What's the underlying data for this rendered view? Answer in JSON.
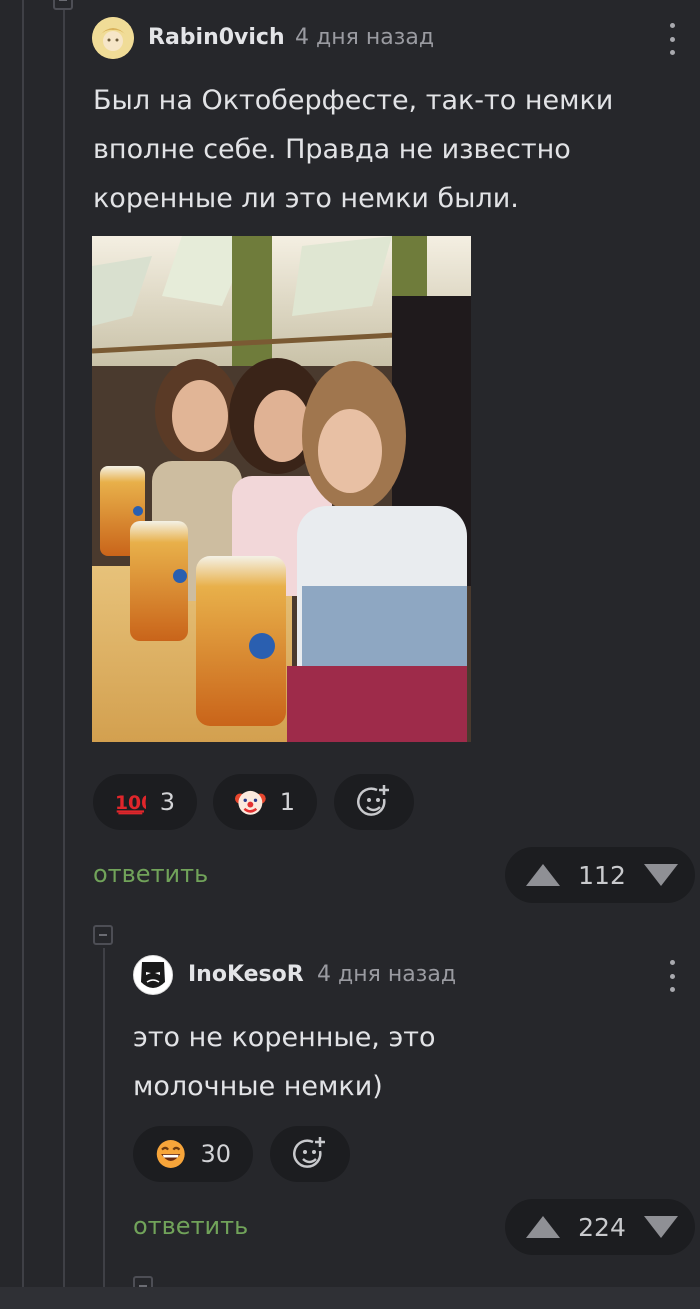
{
  "comments": [
    {
      "username": "Rabin0vich",
      "time": "4 дня назад",
      "text_lines": [
        "Был на Октоберфесте, так-то немки",
        "вполне себе. Правда не известно",
        "коренные ли это немки были."
      ],
      "reactions": [
        {
          "icon": "hundred-points-emoji",
          "count": "3"
        },
        {
          "icon": "clown-face-emoji",
          "count": "1"
        }
      ],
      "add_reaction_icon": "add-reaction-icon",
      "reply_label": "ответить",
      "rating": "112"
    },
    {
      "username": "InoKesoR",
      "time": "4 дня назад",
      "text_lines": [
        "это не коренные, это",
        "молочные немки)"
      ],
      "reactions": [
        {
          "icon": "grinning-face-emoji",
          "count": "30"
        }
      ],
      "add_reaction_icon": "add-reaction-icon",
      "reply_label": "ответить",
      "rating": "224"
    }
  ],
  "colors": {
    "background": "#26272b",
    "pill": "#1c1d20",
    "reply_link": "#71a35a",
    "muted_text": "#9a9ba1"
  }
}
